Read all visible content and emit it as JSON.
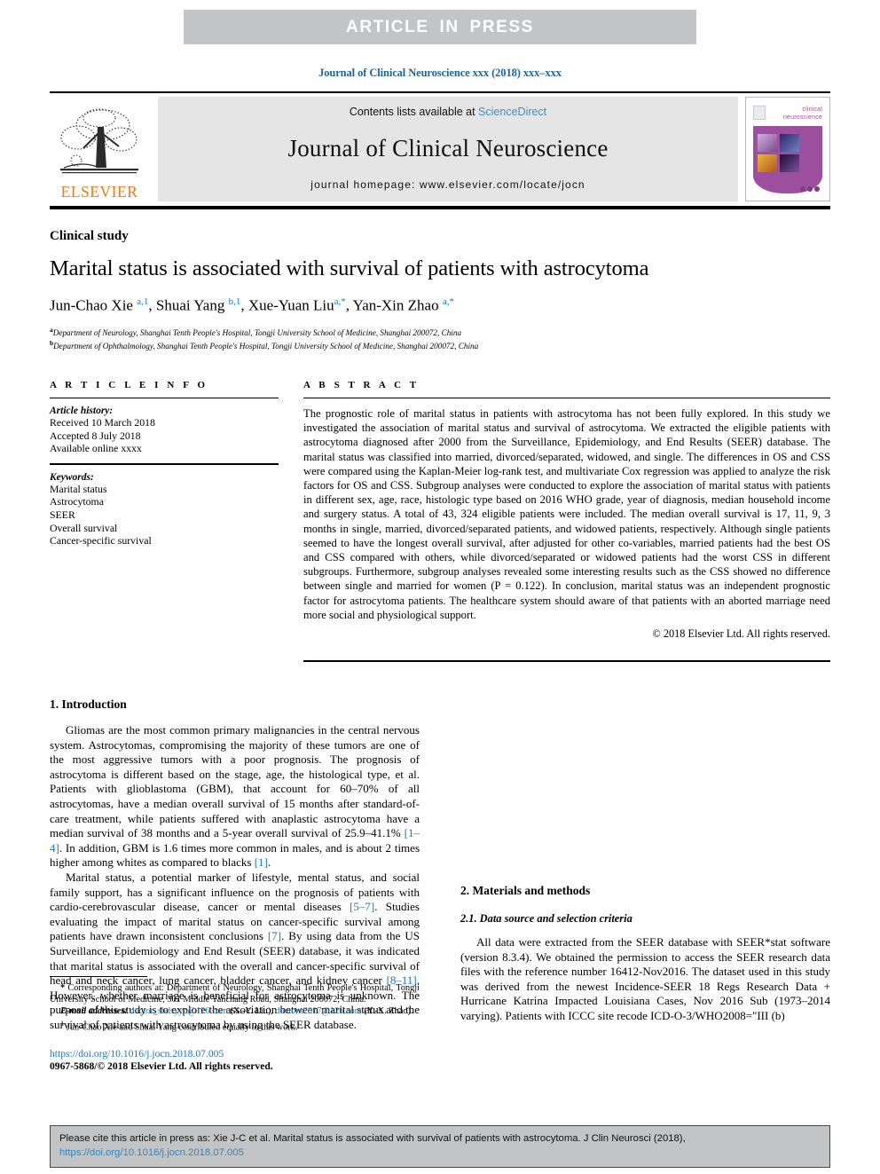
{
  "banner": {
    "text": "ARTICLE IN PRESS",
    "bg_color": "#c3c4c6"
  },
  "running_head": "Journal of Clinical Neuroscience xxx (2018) xxx–xxx",
  "masthead": {
    "contents_prefix": "Contents lists available at ",
    "sciencedirect": "ScienceDirect",
    "journal_name": "Journal of Clinical Neuroscience",
    "homepage": "journal homepage: www.elsevier.com/locate/jocn",
    "publisher": "ELSEVIER",
    "publisher_color": "#e87d1e",
    "cover_title_line1": "clinical",
    "cover_title_line2": "neuroscience",
    "cover_accent": "#9b4f9e"
  },
  "article": {
    "type": "Clinical study",
    "title": "Marital status is associated with survival of patients with astrocytoma",
    "authors_html": "Jun-Chao Xie <sup class=\"aff-mark\">a,1</sup>, Shuai Yang <sup class=\"aff-mark\">b,1</sup>, Xue-Yuan Liu<sup class=\"aff-mark\">a,*</sup>, Yan-Xin Zhao <sup class=\"aff-mark\">a,*</sup>",
    "affiliation_a": "Department of Neurology, Shanghai Tenth People's Hospital, Tongji University School of Medicine, Shanghai 200072, China",
    "affiliation_b": "Department of Ophthalmology, Shanghai Tenth People's Hospital, Tongji University School of Medicine, Shanghai 200072, China"
  },
  "article_info": {
    "heading": "A R T I C L E   I N F O",
    "history_label": "Article history:",
    "received": "Received 10 March 2018",
    "accepted": "Accepted 8 July 2018",
    "available": "Available online xxxx",
    "keywords_label": "Keywords:",
    "keywords": [
      "Marital status",
      "Astrocytoma",
      "SEER",
      "Overall survival",
      "Cancer-specific survival"
    ]
  },
  "abstract": {
    "heading": "A B S T R A C T",
    "text": "The prognostic role of marital status in patients with astrocytoma has not been fully explored. In this study we investigated the association of marital status and survival of astrocytoma. We extracted the eligible patients with astrocytoma diagnosed after 2000 from the Surveillance, Epidemiology, and End Results (SEER) database. The marital status was classified into married, divorced/separated, widowed, and single. The differences in OS and CSS were compared using the Kaplan-Meier log-rank test, and multivariate Cox regression was applied to analyze the risk factors for OS and CSS. Subgroup analyses were conducted to explore the association of marital status with patients in different sex, age, race, histologic type based on 2016 WHO grade, year of diagnosis, median household income and surgery status. A total of 43, 324 eligible patients were included. The median overall survival is 17, 11, 9, 3 months in single, married, divorced/separated patients, and widowed patients, respectively. Although single patients seemed to have the longest overall survival, after adjusted for other co-variables, married patients had the best OS and CSS compared with others, while divorced/separated or widowed patients had the worst CSS in different subgroups. Furthermore, subgroup analyses revealed some interesting results such as the CSS showed no difference between single and married for women (P = 0.122). In conclusion, marital status was an independent prognostic factor for astrocytoma patients. The healthcare system should aware of that patients with an aborted marriage need more social and physiological support.",
    "copyright": "© 2018 Elsevier Ltd. All rights reserved."
  },
  "body": {
    "section1_title": "1. Introduction",
    "para1_html": "Gliomas are the most common primary malignancies in the central nervous system. Astrocytomas, compromising the majority of these tumors are one of the most aggressive tumors with a poor prognosis. The prognosis of astrocytoma is different based on the stage, age, the histological type, et al. Patients with glioblastoma (GBM), that account for 60–70% of all astrocytomas, have a median overall survival of 15 months after standard-of-care treatment, while patients suffered with anaplastic astrocytoma have a median survival of 38 months and a 5-year overall survival of 25.9–41.1% <span class=\"ref\">[1–4]</span>. In addition, GBM is 1.6 times more common in males, and is about 2 times higher among whites as compared to blacks <span class=\"ref\">[1]</span>.",
    "para2_html": "Marital status, a potential marker of lifestyle, mental status, and social family support, has a significant influence on the prognosis of patients with cardio-cerebrovascular disease, cancer or mental diseases <span class=\"ref\">[5–7]</span>. Studies evaluating the impact of marital status on cancer-specific survival among patients have drawn inconsistent conclusions <span class=\"ref\">[7]</span>. By using data from the US Surveillance, Epidemiology and End Result (SEER) database, it was indicated that marital status is associated with the overall and cancer-specific survival of head and neck cancer, lung cancer, bladder cancer, and kidney cancer <span class=\"ref\">[8–11]</span>. However, whether marriage is beneficial for astrocytoma is unknown. The purpose of this study is to explore the association between marital status and the survival of patients with astrocytoma by using the SEER database.",
    "section2_title": "2. Materials and methods",
    "subsection21_title": "2.1. Data source and selection criteria",
    "para3_html": "All data were extracted from the SEER database with SEER*stat software (version 8.3.4). We obtained the permission to access the SEER research data files with the reference number 16412-Nov2016. The dataset used in this study was derived from the newest Incidence-SEER 18 Regs Research Data + Hurricane Katrina Impacted Louisiana Cases, Nov 2016 Sub (1973–2014 varying). Patients with ICCC site recode ICD-O-3/WHO2008=\"III (b)"
  },
  "footnotes": {
    "corresponding_html": "<span style=\"font-weight:bold\">*</span> Corresponding authors at: Department of Neurology, Shanghai Tenth People's Hospital, Tongji University School of Medicine, 301 Middle Yanchang Road, Shanghai 200072, China.",
    "email_html": "<span class=\"fn-em\">E-mail addresses:</span> <span class=\"fn-link\">doctor_shdsyyn@126.com</span> (X.-Y. Liu), <span class=\"fn-link\">doctorx2017@126.com</span> (Y.-X. Zhao).",
    "equal_contrib_html": "<sup>1</sup> Jun-Chao Xie and Shuai Yang contributed equally to this work.",
    "doi": "https://doi.org/10.1016/j.jocn.2018.07.005",
    "issn": "0967-5868/© 2018 Elsevier Ltd. All rights reserved."
  },
  "citation_box": {
    "text_prefix": "Please cite this article in press as: Xie J-C et al. Marital status is associated with survival of patients with astrocytoma. J Clin Neurosci (2018), ",
    "link": "https://doi.org/10.1016/j.jocn.2018.07.005"
  }
}
